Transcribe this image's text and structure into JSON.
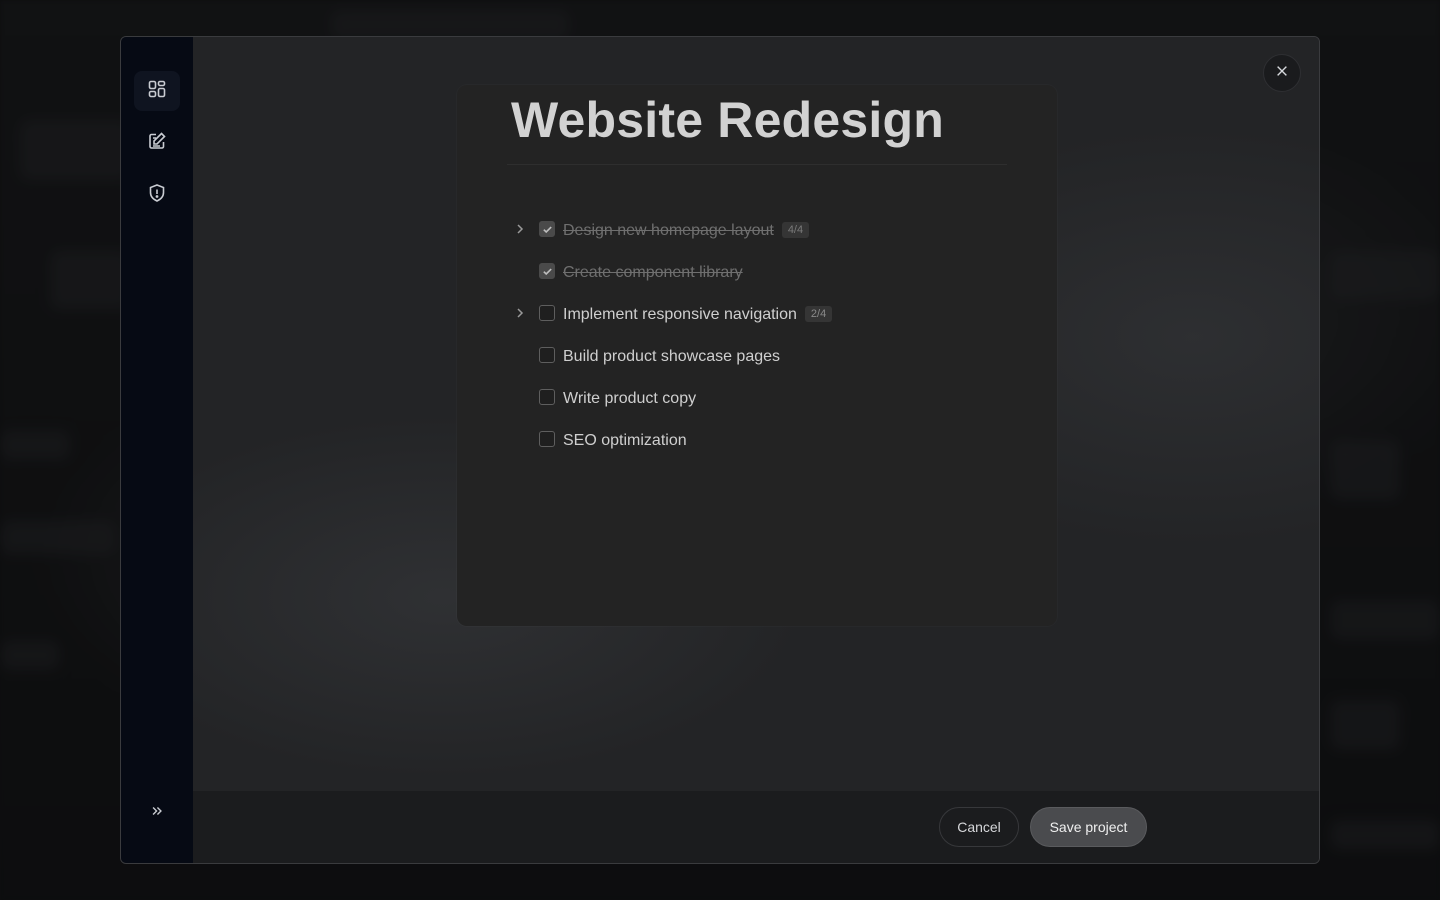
{
  "project": {
    "title": "Website Redesign"
  },
  "tasks": [
    {
      "label": "Design new homepage layout",
      "badge": "4/4",
      "done": true,
      "expandable": true
    },
    {
      "label": "Create component library",
      "badge": "",
      "done": true,
      "expandable": false
    },
    {
      "label": "Implement responsive navigation",
      "badge": "2/4",
      "done": false,
      "expandable": true
    },
    {
      "label": "Build product showcase pages",
      "badge": "",
      "done": false,
      "expandable": false
    },
    {
      "label": "Write product copy",
      "badge": "",
      "done": false,
      "expandable": false
    },
    {
      "label": "SEO optimization",
      "badge": "",
      "done": false,
      "expandable": false
    }
  ],
  "footer": {
    "cancel_label": "Cancel",
    "save_label": "Save project"
  },
  "icons": {
    "rail": [
      "dashboard-icon",
      "edit-note-icon",
      "shield-alert-icon"
    ],
    "expand": "chevrons-right-icon",
    "close": "close-icon"
  }
}
